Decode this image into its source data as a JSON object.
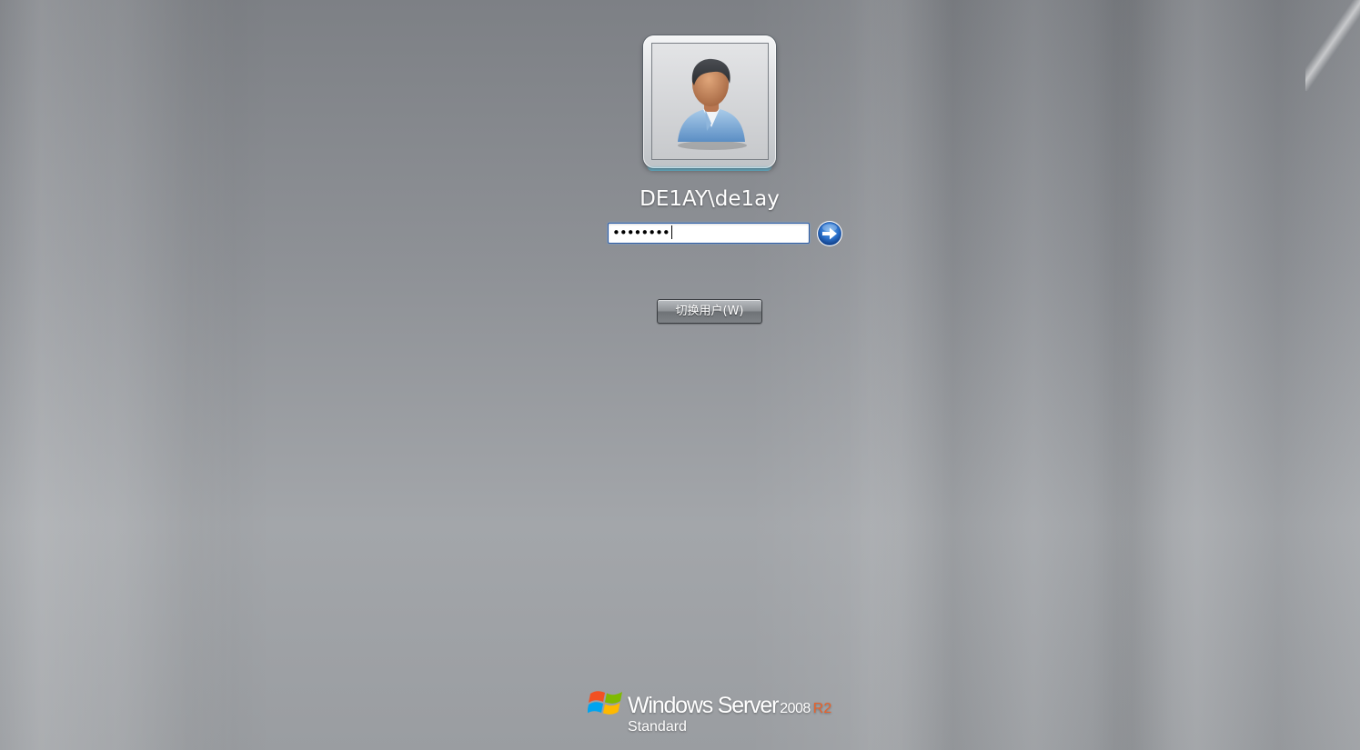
{
  "login": {
    "username": "DE1AY\\de1ay",
    "password_mask": "••••••••",
    "avatar_icon": "user-silhouette-icon",
    "submit_icon": "arrow-right-circle-icon",
    "switch_user_label": "切换用户(W)"
  },
  "branding": {
    "logo_icon": "windows-flag-icon",
    "product_name": "Windows Server",
    "version": "2008",
    "release": "R2",
    "edition": "Standard"
  },
  "colors": {
    "accent_orange": "#e8622b",
    "submit_blue": "#2a6fc9"
  }
}
